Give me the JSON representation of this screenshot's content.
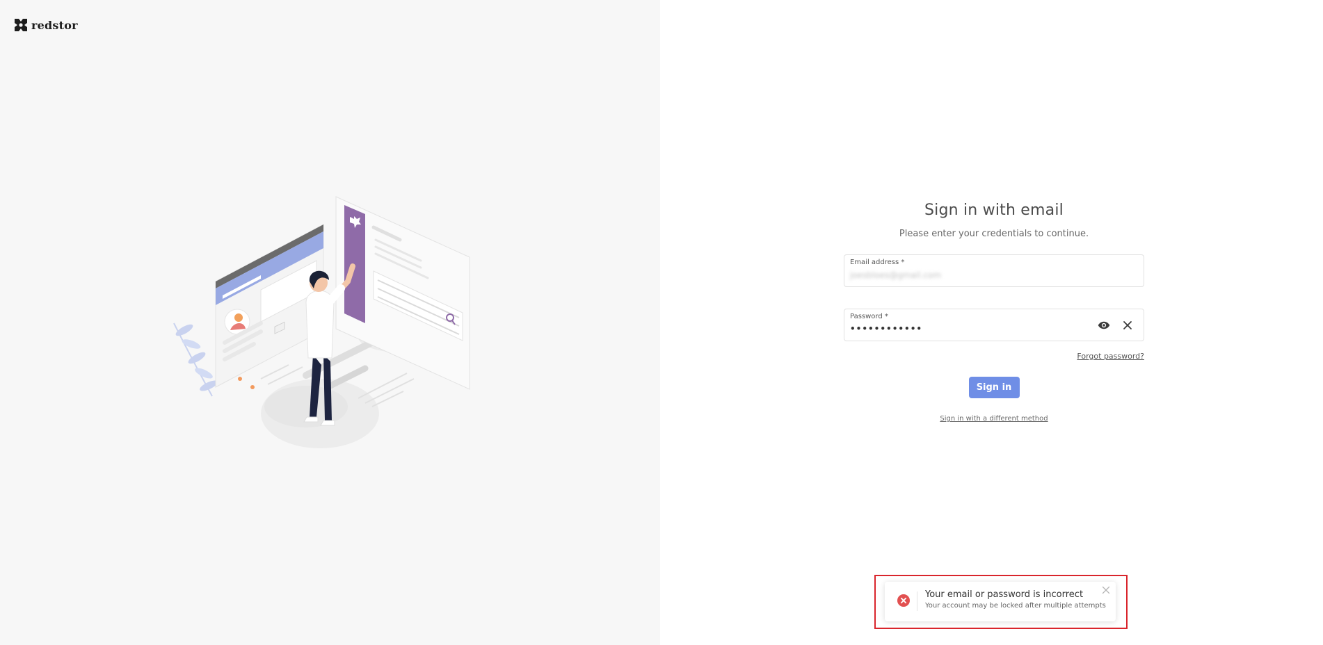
{
  "brand": {
    "name": "redstor",
    "logo_icon": "redstor-logo-icon"
  },
  "illustration": {
    "icon": "person-interacting-with-screens-illustration"
  },
  "signin": {
    "title": "Sign in with email",
    "subtitle": "Please enter your credentials to continue.",
    "email": {
      "label": "Email address *",
      "value": "joesbloes@gmail.com"
    },
    "password": {
      "label": "Password *",
      "value": "••••••••••••",
      "show_icon": "eye-icon",
      "clear_icon": "close-icon"
    },
    "forgot_link": "Forgot password?",
    "submit_label": "Sign in",
    "alt_method_link": "Sign in with a different method"
  },
  "toast": {
    "title": "Your email or password is incorrect",
    "message": "Your account may be locked after multiple attempts",
    "icon": "error-circle-icon",
    "close_icon": "close-icon"
  },
  "colors": {
    "accent": "#6f8ee6",
    "error": "#e25050",
    "highlight": "#d9252c",
    "left_bg": "#f7f7f7"
  }
}
